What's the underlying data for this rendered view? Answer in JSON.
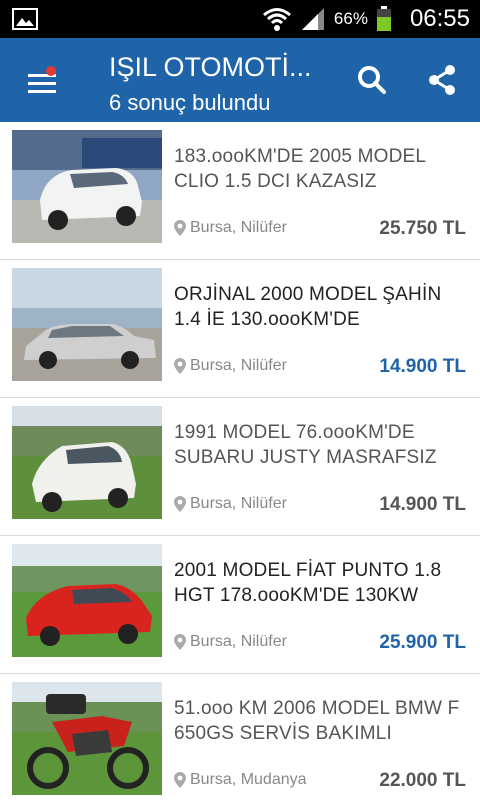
{
  "statusbar": {
    "battery_percent": "66%",
    "time": "06:55",
    "icons": [
      "image-notification-icon",
      "wifi-icon",
      "signal-icon",
      "battery-icon"
    ]
  },
  "appbar": {
    "title": "IŞIL OTOMOTİ...",
    "subtitle": "6 sonuç bulundu",
    "icons": [
      "menu-icon",
      "search-icon",
      "share-icon"
    ],
    "notification_dot_color": "#e53935",
    "background": "#1f63a8"
  },
  "listings": [
    {
      "title": "183.oooKM'DE 2005 MODEL CLIO 1.5 DCI KAZASIZ",
      "location": "Bursa, Nilüfer",
      "price": "25.750 TL",
      "highlighted": false,
      "photo": "white Renault Clio"
    },
    {
      "title": "ORJİNAL 2000 MODEL ŞAHİN 1.4 İE 130.oooKM'DE",
      "location": "Bursa, Nilüfer",
      "price": "14.900 TL",
      "highlighted": true,
      "photo": "silver Tofaş Şahin sedan"
    },
    {
      "title": "1991 MODEL 76.oooKM'DE SUBARU JUSTY MASRAFSIZ",
      "location": "Bursa, Nilüfer",
      "price": "14.900 TL",
      "highlighted": false,
      "photo": "white Subaru Justy on grass"
    },
    {
      "title": "2001 MODEL FİAT PUNTO 1.8 HGT 178.oooKM'DE 130KW",
      "location": "Bursa, Nilüfer",
      "price": "25.900 TL",
      "highlighted": true,
      "photo": "red Fiat Punto on grass"
    },
    {
      "title": "51.ooo KM 2006 MODEL BMW F 650GS SERVİS BAKIMLI",
      "location": "Bursa, Mudanya",
      "price": "22.000 TL",
      "highlighted": false,
      "photo": "red BMW F 650GS motorcycle"
    }
  ]
}
